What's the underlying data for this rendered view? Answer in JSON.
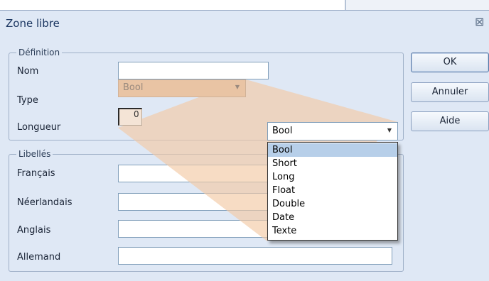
{
  "dialog": {
    "title": "Zone libre",
    "close_glyph": "⊠"
  },
  "definition": {
    "legend": "Définition",
    "nom_label": "Nom",
    "nom_value": "",
    "type_label": "Type",
    "type_value": "Bool",
    "longueur_label": "Longueur",
    "longueur_value": "0"
  },
  "libelles": {
    "legend": "Libellés",
    "fields": [
      {
        "label": "Français",
        "value": ""
      },
      {
        "label": "Néerlandais",
        "value": ""
      },
      {
        "label": "Anglais",
        "value": ""
      },
      {
        "label": "Allemand",
        "value": ""
      }
    ]
  },
  "buttons": {
    "ok": "OK",
    "annuler": "Annuler",
    "aide": "Aide"
  },
  "type_dropdown": {
    "selected": "Bool",
    "options": [
      "Bool",
      "Short",
      "Long",
      "Float",
      "Double",
      "Date",
      "Texte"
    ],
    "highlighted_index": 0
  },
  "colors": {
    "dialog_bg": "#dfe8f5",
    "zoom_callout": "#f2c9a5",
    "highlight": "#b7cfe9"
  },
  "icons": {
    "dropdown_arrow": "▼",
    "close": "close-icon"
  }
}
